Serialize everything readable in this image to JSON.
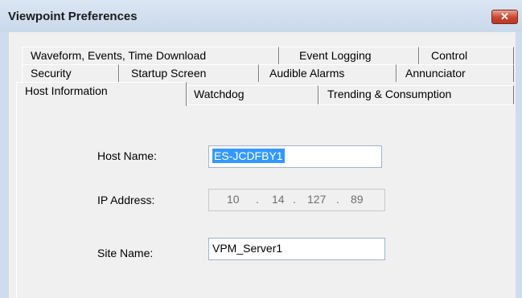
{
  "window": {
    "title": "Viewpoint Preferences",
    "close_label": "✕"
  },
  "tabs": {
    "row1": [
      "Waveform, Events, Time Download",
      "Event Logging",
      "Control"
    ],
    "row2": [
      "Security",
      "Startup Screen",
      "Audible Alarms",
      "Annunciator"
    ],
    "row3": [
      "Host Information",
      "Watchdog",
      "Trending & Consumption"
    ],
    "active": "Host Information"
  },
  "host_info": {
    "host_name_label": "Host Name:",
    "host_name_value": "ES-JCDFBY1",
    "ip_address_label": "IP Address:",
    "ip_octets": [
      "10",
      "14",
      "127",
      "89"
    ],
    "ip_separator": ".",
    "site_name_label": "Site Name:",
    "site_name_value": "VPM_Server1"
  }
}
